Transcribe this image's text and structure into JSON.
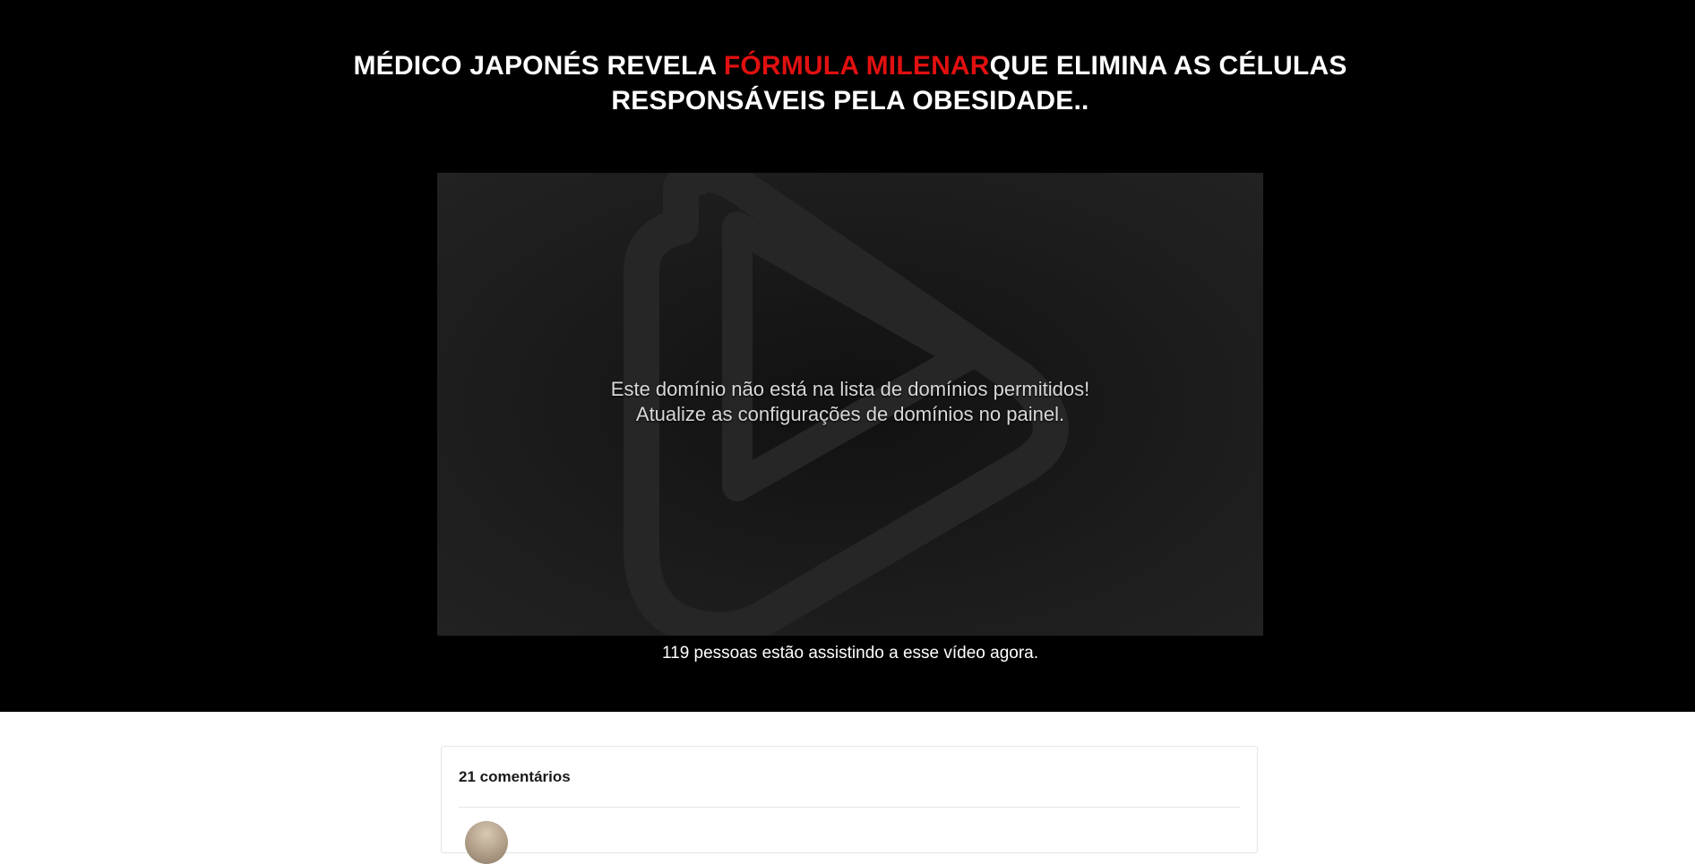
{
  "headline": {
    "part1": "MÉDICO JAPONÉS REVELA ",
    "accent": "FÓRMULA MILENAR",
    "part2": "QUE ELIMINA AS CÉLULAS RESPONSÁVEIS PELA OBESIDADE..",
    "accent_color": "#e11010"
  },
  "player": {
    "message_line1": "Este domínio não está na lista de domínios permitidos!",
    "message_line2": "Atualize as configurações de domínios no painel.",
    "icon": "play-logo-icon"
  },
  "viewers": {
    "text": "119 pessoas estão assistindo a esse vídeo agora."
  },
  "comments": {
    "count_label": "21 comentários"
  }
}
